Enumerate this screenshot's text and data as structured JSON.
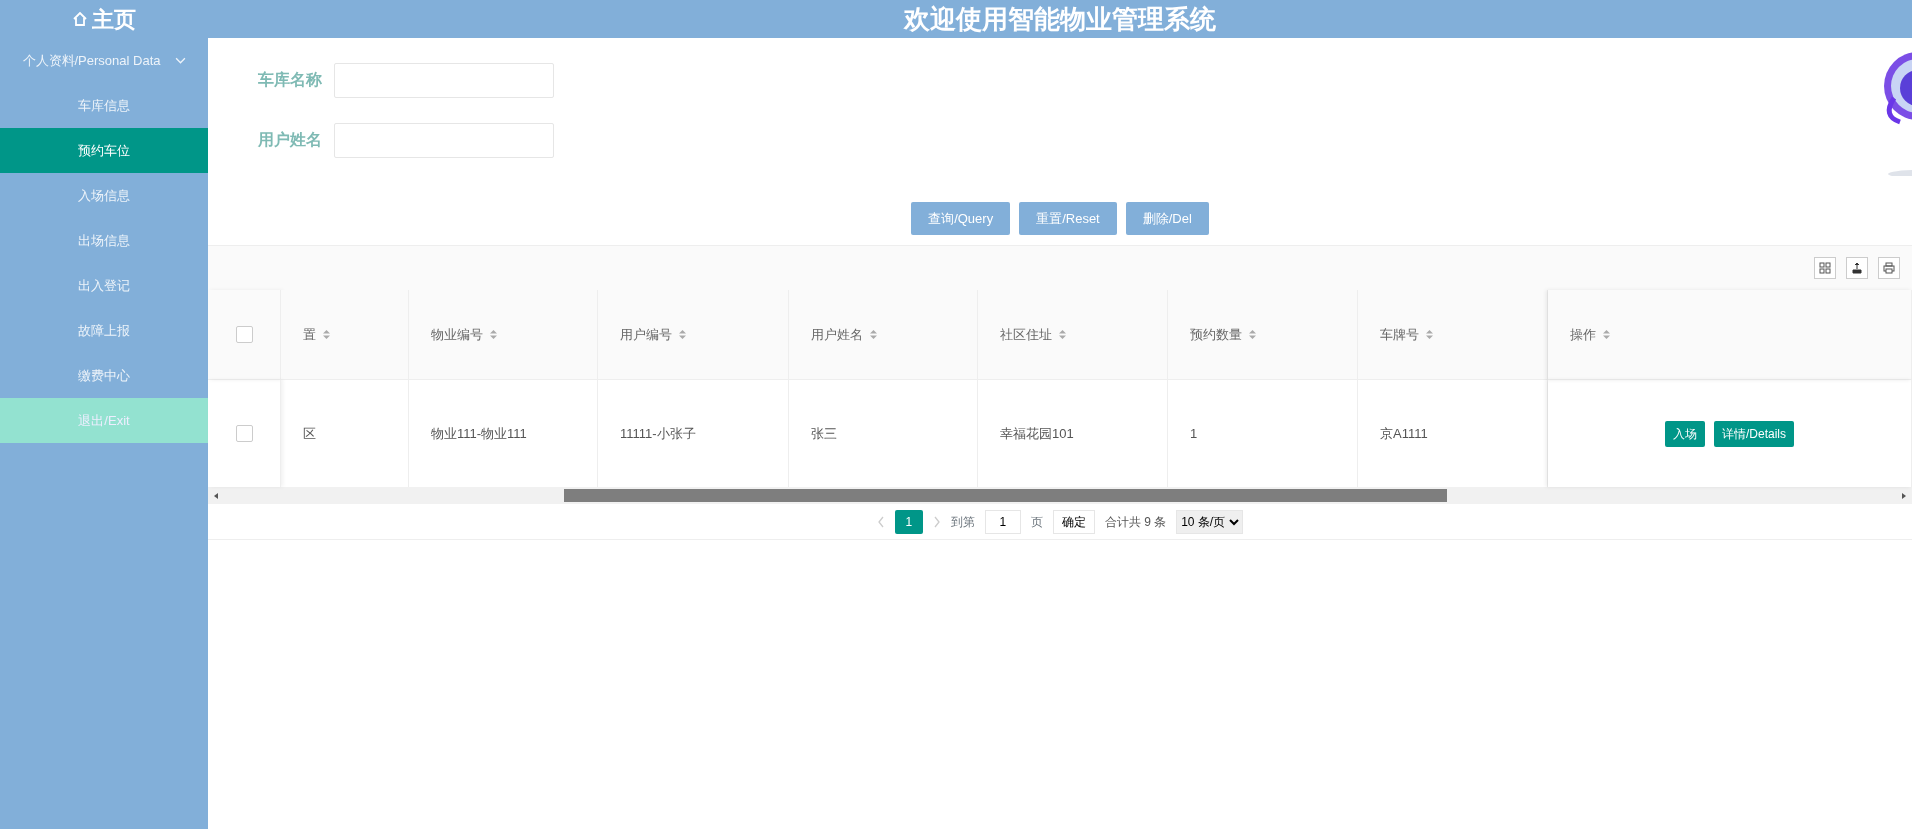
{
  "header": {
    "home_label": "主页",
    "title": "欢迎使用智能物业管理系统"
  },
  "sidebar": {
    "items": [
      {
        "label": "个人资料/Personal Data",
        "kind": "group",
        "expanded": true,
        "selected": false
      },
      {
        "label": "车库信息",
        "kind": "link",
        "selected": false
      },
      {
        "label": "预约车位",
        "kind": "link",
        "selected": true
      },
      {
        "label": "入场信息",
        "kind": "link",
        "selected": false
      },
      {
        "label": "出场信息",
        "kind": "link",
        "selected": false
      },
      {
        "label": "出入登记",
        "kind": "link",
        "selected": false
      },
      {
        "label": "故障上报",
        "kind": "link",
        "selected": false
      },
      {
        "label": "缴费中心",
        "kind": "link",
        "selected": false
      },
      {
        "label": "退出/Exit",
        "kind": "exit",
        "selected": false
      }
    ]
  },
  "search_form": {
    "fields": [
      {
        "label": "车库名称"
      },
      {
        "label": "用户姓名"
      }
    ]
  },
  "buttons": [
    "查询/Query",
    "重置/Reset",
    "删除/Del"
  ],
  "table": {
    "all_checked": false,
    "columns": [
      "置",
      "物业编号",
      "用户编号",
      "用户姓名",
      "社区住址",
      "预约数量",
      "车牌号",
      "操作"
    ],
    "rows": [
      {
        "checked": false,
        "cells": [
          "区",
          "物业111-物业111",
          "11111-小张子",
          "张三",
          "幸福花园101",
          "1",
          "京A1111"
        ],
        "actions": [
          "入场",
          "详情/Details"
        ]
      }
    ]
  },
  "pagination": {
    "current_page": "1",
    "goto_label": "到第",
    "goto_value": "1",
    "page_label": "页",
    "confirm": "确定",
    "total": "合计共 9 条",
    "page_size": "10 条/页"
  }
}
